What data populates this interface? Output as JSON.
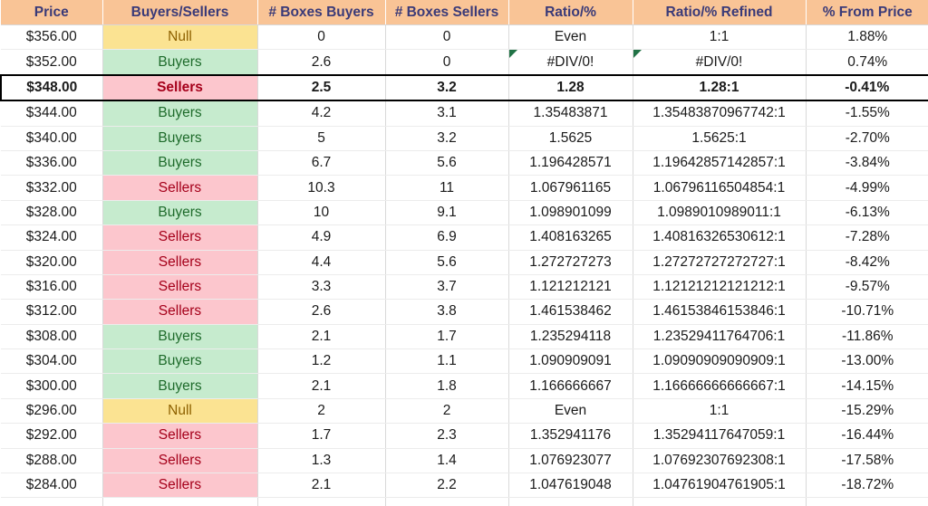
{
  "sheet": {
    "columns": [
      {
        "key": "price",
        "label": "Price"
      },
      {
        "key": "bs",
        "label": "Buyers/Sellers"
      },
      {
        "key": "bb",
        "label": "# Boxes Buyers"
      },
      {
        "key": "bsel",
        "label": "# Boxes Sellers"
      },
      {
        "key": "ratio",
        "label": "Ratio/%"
      },
      {
        "key": "refined",
        "label": "Ratio/% Refined"
      },
      {
        "key": "frompx",
        "label": "% From Price"
      }
    ],
    "colors": {
      "header_fill": "#F9C496",
      "header_text": "#3A3A78",
      "buyers_fill": "#C6EBCE",
      "buyers_text": "#1E6B2B",
      "sellers_fill": "#FCC6CD",
      "sellers_text": "#A5001A",
      "null_fill": "#FBE392",
      "null_text": "#8E6100",
      "comment_marker": "#217346",
      "focus_border": "#000000"
    },
    "rows": [
      {
        "price": "$356.00",
        "bs": "Null",
        "status": "null",
        "bb": "0",
        "bsel": "0",
        "ratio": "Even",
        "refined": "1:1",
        "frompx": "1.88%",
        "focus": false,
        "comment_ratio": false,
        "comment_refined": false
      },
      {
        "price": "$352.00",
        "bs": "Buyers",
        "status": "buyers",
        "bb": "2.6",
        "bsel": "0",
        "ratio": "#DIV/0!",
        "refined": "#DIV/0!",
        "frompx": "0.74%",
        "focus": false,
        "comment_ratio": true,
        "comment_refined": true
      },
      {
        "price": "$348.00",
        "bs": "Sellers",
        "status": "sellers",
        "bb": "2.5",
        "bsel": "3.2",
        "ratio": "1.28",
        "refined": "1.28:1",
        "frompx": "-0.41%",
        "focus": true,
        "comment_ratio": false,
        "comment_refined": false
      },
      {
        "price": "$344.00",
        "bs": "Buyers",
        "status": "buyers",
        "bb": "4.2",
        "bsel": "3.1",
        "ratio": "1.35483871",
        "refined": "1.35483870967742:1",
        "frompx": "-1.55%",
        "focus": false,
        "comment_ratio": false,
        "comment_refined": false
      },
      {
        "price": "$340.00",
        "bs": "Buyers",
        "status": "buyers",
        "bb": "5",
        "bsel": "3.2",
        "ratio": "1.5625",
        "refined": "1.5625:1",
        "frompx": "-2.70%",
        "focus": false,
        "comment_ratio": false,
        "comment_refined": false
      },
      {
        "price": "$336.00",
        "bs": "Buyers",
        "status": "buyers",
        "bb": "6.7",
        "bsel": "5.6",
        "ratio": "1.196428571",
        "refined": "1.19642857142857:1",
        "frompx": "-3.84%",
        "focus": false,
        "comment_ratio": false,
        "comment_refined": false
      },
      {
        "price": "$332.00",
        "bs": "Sellers",
        "status": "sellers",
        "bb": "10.3",
        "bsel": "11",
        "ratio": "1.067961165",
        "refined": "1.06796116504854:1",
        "frompx": "-4.99%",
        "focus": false,
        "comment_ratio": false,
        "comment_refined": false
      },
      {
        "price": "$328.00",
        "bs": "Buyers",
        "status": "buyers",
        "bb": "10",
        "bsel": "9.1",
        "ratio": "1.098901099",
        "refined": "1.0989010989011:1",
        "frompx": "-6.13%",
        "focus": false,
        "comment_ratio": false,
        "comment_refined": false
      },
      {
        "price": "$324.00",
        "bs": "Sellers",
        "status": "sellers",
        "bb": "4.9",
        "bsel": "6.9",
        "ratio": "1.408163265",
        "refined": "1.40816326530612:1",
        "frompx": "-7.28%",
        "focus": false,
        "comment_ratio": false,
        "comment_refined": false
      },
      {
        "price": "$320.00",
        "bs": "Sellers",
        "status": "sellers",
        "bb": "4.4",
        "bsel": "5.6",
        "ratio": "1.272727273",
        "refined": "1.27272727272727:1",
        "frompx": "-8.42%",
        "focus": false,
        "comment_ratio": false,
        "comment_refined": false
      },
      {
        "price": "$316.00",
        "bs": "Sellers",
        "status": "sellers",
        "bb": "3.3",
        "bsel": "3.7",
        "ratio": "1.121212121",
        "refined": "1.12121212121212:1",
        "frompx": "-9.57%",
        "focus": false,
        "comment_ratio": false,
        "comment_refined": false
      },
      {
        "price": "$312.00",
        "bs": "Sellers",
        "status": "sellers",
        "bb": "2.6",
        "bsel": "3.8",
        "ratio": "1.461538462",
        "refined": "1.46153846153846:1",
        "frompx": "-10.71%",
        "focus": false,
        "comment_ratio": false,
        "comment_refined": false
      },
      {
        "price": "$308.00",
        "bs": "Buyers",
        "status": "buyers",
        "bb": "2.1",
        "bsel": "1.7",
        "ratio": "1.235294118",
        "refined": "1.23529411764706:1",
        "frompx": "-11.86%",
        "focus": false,
        "comment_ratio": false,
        "comment_refined": false
      },
      {
        "price": "$304.00",
        "bs": "Buyers",
        "status": "buyers",
        "bb": "1.2",
        "bsel": "1.1",
        "ratio": "1.090909091",
        "refined": "1.09090909090909:1",
        "frompx": "-13.00%",
        "focus": false,
        "comment_ratio": false,
        "comment_refined": false
      },
      {
        "price": "$300.00",
        "bs": "Buyers",
        "status": "buyers",
        "bb": "2.1",
        "bsel": "1.8",
        "ratio": "1.166666667",
        "refined": "1.16666666666667:1",
        "frompx": "-14.15%",
        "focus": false,
        "comment_ratio": false,
        "comment_refined": false
      },
      {
        "price": "$296.00",
        "bs": "Null",
        "status": "null",
        "bb": "2",
        "bsel": "2",
        "ratio": "Even",
        "refined": "1:1",
        "frompx": "-15.29%",
        "focus": false,
        "comment_ratio": false,
        "comment_refined": false
      },
      {
        "price": "$292.00",
        "bs": "Sellers",
        "status": "sellers",
        "bb": "1.7",
        "bsel": "2.3",
        "ratio": "1.352941176",
        "refined": "1.35294117647059:1",
        "frompx": "-16.44%",
        "focus": false,
        "comment_ratio": false,
        "comment_refined": false
      },
      {
        "price": "$288.00",
        "bs": "Sellers",
        "status": "sellers",
        "bb": "1.3",
        "bsel": "1.4",
        "ratio": "1.076923077",
        "refined": "1.07692307692308:1",
        "frompx": "-17.58%",
        "focus": false,
        "comment_ratio": false,
        "comment_refined": false
      },
      {
        "price": "$284.00",
        "bs": "Sellers",
        "status": "sellers",
        "bb": "2.1",
        "bsel": "2.2",
        "ratio": "1.047619048",
        "refined": "1.04761904761905:1",
        "frompx": "-18.72%",
        "focus": false,
        "comment_ratio": false,
        "comment_refined": false
      }
    ]
  }
}
